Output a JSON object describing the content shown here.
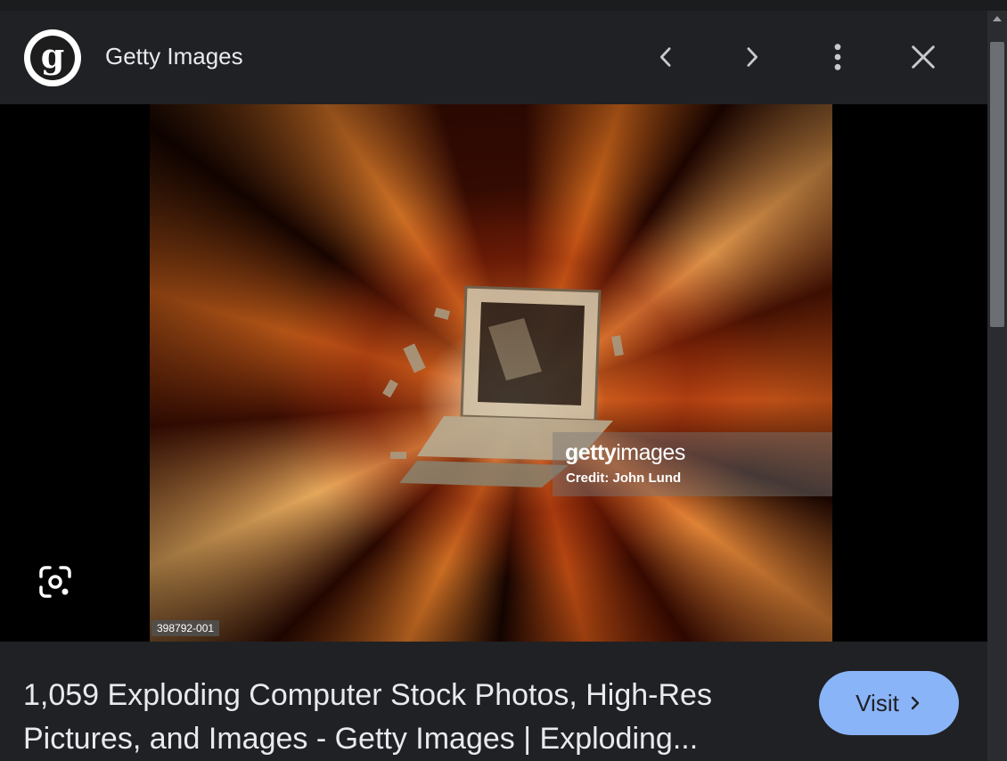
{
  "header": {
    "source_name": "Getty Images",
    "logo_letter": "g",
    "icons": {
      "previous": "chevron-left-icon",
      "next": "chevron-right-icon",
      "more": "more-vert-icon",
      "close": "close-icon"
    }
  },
  "image": {
    "watermark_brand_bold": "getty",
    "watermark_brand_rest": "images",
    "watermark_credit": "Credit: John Lund",
    "image_id": "398792-001",
    "lens_icon": "google-lens-icon"
  },
  "footer": {
    "title_line1": "1,059 Exploding Computer Stock Photos, High-Res",
    "title_line2": "Pictures, and Images - Getty Images | Exploding...",
    "visit_label": "Visit",
    "visit_icon": "chevron-right-icon",
    "accent_color": "#8ab4f8"
  },
  "colors": {
    "background": "#202124",
    "text": "#e8eaed",
    "viewer_background": "#000000"
  }
}
